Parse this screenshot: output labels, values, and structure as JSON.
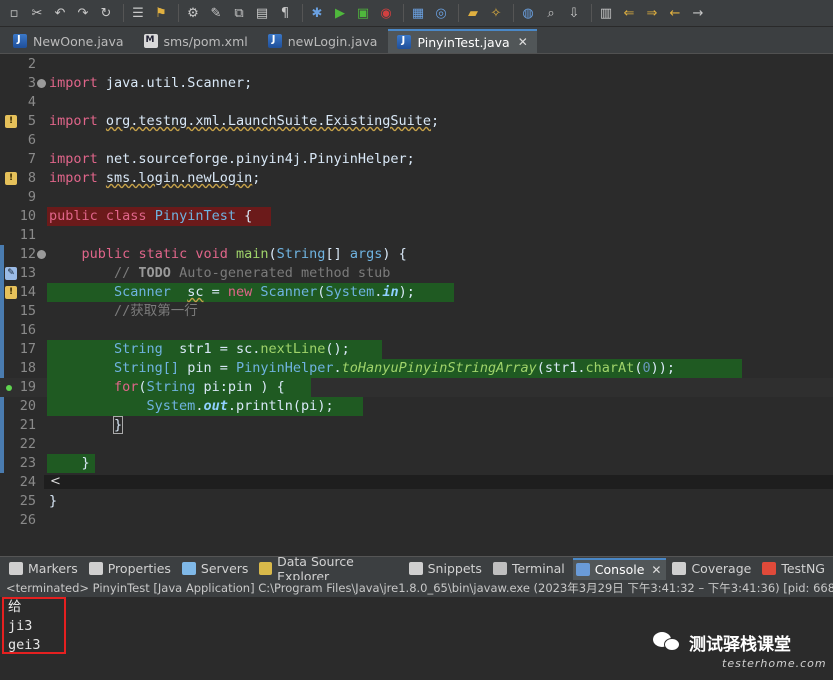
{
  "toolbar": {
    "icons": [
      "new-icon",
      "save-icon",
      "back-icon",
      "forward-icon",
      "refresh-icon",
      "outline-icon",
      "debug-icon",
      "tools-icon",
      "edit-icon",
      "copy-icon",
      "paste-icon",
      "paragraph-icon",
      "run-target-icon",
      "run-icon",
      "run-config-icon",
      "coverage-icon",
      "new-package-icon",
      "web-icon",
      "open-icon",
      "wand-icon",
      "globe-icon",
      "search-icon",
      "download-icon",
      "properties-icon",
      "prev-icon",
      "next-icon",
      "history-back-icon",
      "history-forward-icon"
    ]
  },
  "editor_tabs": [
    {
      "label": "NewOone.java",
      "icon": "java-file-icon",
      "active": false
    },
    {
      "label": "sms/pom.xml",
      "icon": "maven-file-icon",
      "active": false
    },
    {
      "label": "newLogin.java",
      "icon": "java-file-icon",
      "active": false
    },
    {
      "label": "PinyinTest.java",
      "icon": "java-file-icon",
      "active": true
    }
  ],
  "code": {
    "line_numbers": [
      "2",
      "3",
      "4",
      "5",
      "6",
      "7",
      "8",
      "9",
      "10",
      "11",
      "12",
      "13",
      "14",
      "15",
      "16",
      "17",
      "18",
      "19",
      "20",
      "21",
      "22",
      "23",
      "24",
      "25",
      "26"
    ],
    "import_kw": "import",
    "l3_path": "java.util.Scanner",
    "l5_path": "org.testng.xml.LaunchSuite.ExistingSuite",
    "l7_path": "net.sourceforge.pinyin4j.PinyinHelper",
    "l8_path": "sms.login.newLogin",
    "semicolon": ";",
    "public": "public",
    "class": "class",
    "classname": "PinyinTest",
    "open_brace": "{",
    "close_brace": "}",
    "static": "static",
    "void": "void",
    "main": "main",
    "string_type": "String",
    "string_arr": "String[]",
    "args": "args",
    "todo_comment_pre": "// ",
    "todo": "TODO",
    "todo_comment_post": " Auto-generated method stub",
    "scanner_type": "Scanner",
    "sc": "sc",
    "eq": " = ",
    "new": "new",
    "system": "System",
    "in_field": "in",
    "comment_first_line": "//获取第一行",
    "str1": "str1",
    "nextline": "nextLine",
    "pin": "pin",
    "pinyinhelper": "PinyinHelper",
    "method_call": "toHanyuPinyinStringArray",
    "charat": "charAt",
    "zero": "0",
    "for_kw": "for",
    "pi": "pi",
    "out_field": "out",
    "println": "println"
  },
  "bottom_tabs": [
    {
      "label": "Markers",
      "icon": "markers-icon",
      "color": "#cfcfcf"
    },
    {
      "label": "Properties",
      "icon": "properties-icon",
      "color": "#cfcfcf"
    },
    {
      "label": "Servers",
      "icon": "servers-icon",
      "color": "#7fb8e8"
    },
    {
      "label": "Data Source Explorer",
      "icon": "data-source-icon",
      "color": "#d9b94a"
    },
    {
      "label": "Snippets",
      "icon": "snippets-icon",
      "color": "#cfcfcf"
    },
    {
      "label": "Terminal",
      "icon": "terminal-icon",
      "color": "#bfbfbf"
    },
    {
      "label": "Console",
      "icon": "console-icon",
      "color": "#6a9bd8"
    },
    {
      "label": "Coverage",
      "icon": "coverage-icon",
      "color": "#cfcfcf"
    },
    {
      "label": "TestNG",
      "icon": "testng-icon",
      "color": "#e04a3a"
    }
  ],
  "console_status": "<terminated> PinyinTest [Java Application] C:\\Program Files\\Java\\jre1.8.0_65\\bin\\javaw.exe  (2023年3月29日 下午3:41:32 – 下午3:41:36) [pid: 668",
  "console_output": [
    "给",
    "ji3",
    "gei3"
  ],
  "watermark": {
    "title": "测试驿栈课堂",
    "subtitle": "testerhome.com"
  }
}
